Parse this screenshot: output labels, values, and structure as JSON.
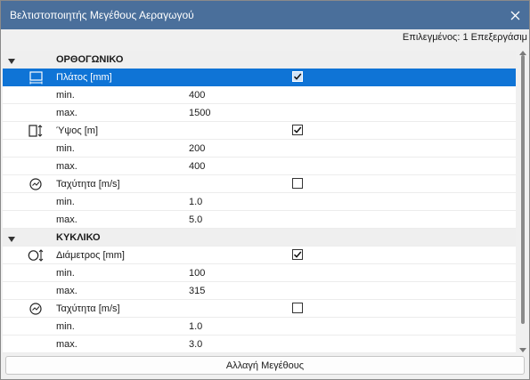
{
  "window": {
    "title": "Βελτιστοποιητής Μεγέθους Αεραγωγού",
    "close_icon": "close-icon",
    "titlebar_color": "#4a6f9b"
  },
  "selection_info": "Επιλεγμένος: 1 Επεξεργάσιμ",
  "groups": [
    {
      "label": "ΟΡΘΟΓΩΝΙΚΟ",
      "params": [
        {
          "icon": "duct-width-icon",
          "label": "Πλάτος [mm]",
          "checked": true,
          "selected": true,
          "min_label": "min.",
          "min": "400",
          "max_label": "max.",
          "max": "1500"
        },
        {
          "icon": "duct-height-icon",
          "label": "Ύψος [m]",
          "checked": true,
          "selected": false,
          "min_label": "min.",
          "min": "200",
          "max_label": "max.",
          "max": "400"
        },
        {
          "icon": "speed-gauge-icon",
          "label": "Ταχύτητα [m/s]",
          "checked": false,
          "selected": false,
          "min_label": "min.",
          "min": "1.0",
          "max_label": "max.",
          "max": "5.0"
        }
      ]
    },
    {
      "label": "ΚΥΚΛΙΚΟ",
      "params": [
        {
          "icon": "duct-diameter-icon",
          "label": "Διάμετρος [mm]",
          "checked": true,
          "selected": false,
          "min_label": "min.",
          "min": "100",
          "max_label": "max.",
          "max": "315"
        },
        {
          "icon": "speed-gauge-icon",
          "label": "Ταχύτητα [m/s]",
          "checked": false,
          "selected": false,
          "min_label": "min.",
          "min": "1.0",
          "max_label": "max.",
          "max": "3.0"
        }
      ]
    }
  ],
  "resize_button_label": "Αλλαγή Μεγέθους",
  "selection_color": "#0f74d6"
}
